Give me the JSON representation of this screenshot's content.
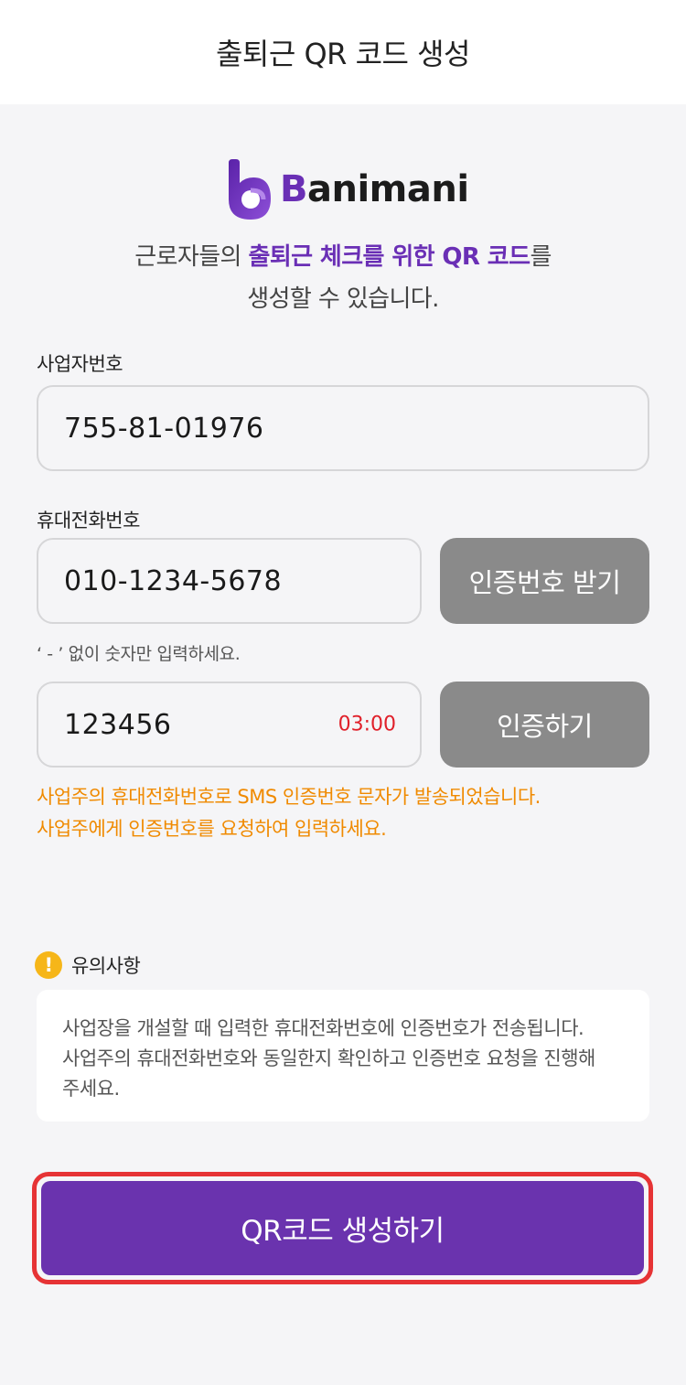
{
  "header": {
    "title": "출퇴근 QR 코드 생성"
  },
  "logo": {
    "initial": "B",
    "rest": "animani"
  },
  "intro": {
    "line1_prefix": "근로자들의 ",
    "line1_highlight": "출퇴근 체크를 위한 QR 코드",
    "line1_suffix": "를",
    "line2": "생성할 수 있습니다."
  },
  "business": {
    "label": "사업자번호",
    "value": "755-81-01976"
  },
  "phone": {
    "label": "휴대전화번호",
    "value": "010-1234-5678",
    "request_button": "인증번호 받기",
    "hint": "‘ - ’ 없이 숫자만 입력하세요."
  },
  "verify": {
    "code_value": "123456",
    "timer": "03:00",
    "verify_button": "인증하기",
    "message_line1": "사업주의 휴대전화번호로 SMS 인증번호 문자가 발송되었습니다.",
    "message_line2": "사업주에게 인증번호를 요청하여 입력하세요."
  },
  "notice": {
    "title": "유의사항",
    "icon": "exclamation-icon",
    "line1": "사업장을 개설할 때 입력한 휴대전화번호에 인증번호가 전송됩니다.",
    "line2": "사업주의 휴대전화번호와 동일한지 확인하고 인증번호 요청을 진행해",
    "line3": "주세요."
  },
  "cta": {
    "label": "QR코드 생성하기"
  },
  "colors": {
    "brand": "#6a33ae",
    "warning_text": "#f08a00",
    "timer": "#e0202a",
    "button_gray": "#8a8a8a",
    "highlight_outline": "#e63335"
  }
}
